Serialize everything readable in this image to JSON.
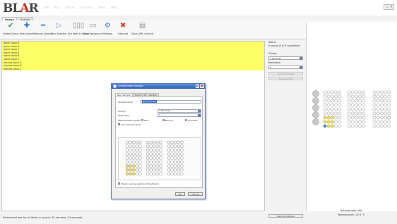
{
  "app": {
    "logo_main": "BL",
    "logo_accent": "A",
    "logo_end": "R",
    "menu": [
      "File",
      "Run",
      "Queue",
      "Columns",
      "Tools",
      "Help"
    ]
  },
  "tabs": [
    "Queue",
    "Analysis"
  ],
  "ribbon": [
    {
      "label": "Enable Queue",
      "icon": "enable-queue-icon",
      "glyph": "✔",
      "color": "#3a9a3a"
    },
    {
      "label": "New Sample",
      "icon": "new-sample-icon",
      "glyph": "✚",
      "color": "#2b73c9"
    },
    {
      "label": "Remove Sample",
      "icon": "remove-sample-icon",
      "glyph": "━",
      "color": "#2b73c9"
    },
    {
      "label": "Run Selected",
      "icon": "run-selected-icon",
      "glyph": "▷",
      "color": "#7a8fc0"
    },
    {
      "label": "Run Next In Queue",
      "icon": "run-next-icon",
      "glyph": "▯▯▯",
      "color": "#8a8a8a"
    },
    {
      "label": "View Background",
      "icon": "view-background-icon",
      "glyph": "▭",
      "color": "#8a8a8a"
    },
    {
      "label": "Settings",
      "icon": "settings-icon",
      "glyph": "⚙",
      "color": "#3c7fd0"
    },
    {
      "label": "Interrupt",
      "icon": "interrupt-icon",
      "glyph": "✖",
      "color": "#d23c2c"
    },
    {
      "label": "Show LIMS Controls",
      "icon": "lims-controls-icon",
      "glyph": "▤",
      "color": "#8a8a8a"
    }
  ],
  "queue": {
    "rows": [
      "green liquor A",
      "green liquor B",
      "green liquor C",
      "spent liquor A",
      "spent liquor B",
      "spent liquor C",
      "process liquor A",
      "process liquor B",
      "process liquor C"
    ],
    "highlight_color": "#ffff66"
  },
  "status_text": "Estimated time for all items in queue: 35 minutes, 24 seconds.",
  "side": {
    "status_label": "Status:",
    "status_value": "In queue (0 of 3 completed)",
    "priority_label": "Priority:",
    "priority_value": "1 (Normal)",
    "replicates_label": "Replicates:",
    "replicates_value": "3",
    "convert_button": "Convert Sample",
    "save_button": "Save Sample",
    "remove_button": "Remove Sample"
  },
  "autosampler": {
    "idle_text": "Autosampler idle.",
    "temperature_text": "Temperature: 22.0 °C"
  },
  "dialog": {
    "title": "Create New Sample",
    "tab_new": "New Sample",
    "tab_import": "Import CSV / Sample",
    "sample_name_label": "Sample name:",
    "sample_name_value": "New Sample",
    "priority_label": "Priority:",
    "priority_value": "1 (Normal)",
    "replicates_label": "Replicates:",
    "replicates_value": "3",
    "measurement_label": "Measurement speed:",
    "speed_options": [
      "Fast",
      "Normal",
      "Accurate"
    ],
    "speed_selected": "Normal",
    "run_wall_label": "Run wall (sec/pos)",
    "begin_checkbox": "Begin running sample immediately",
    "ok_button": "OK",
    "cancel_button": "Cancel"
  }
}
